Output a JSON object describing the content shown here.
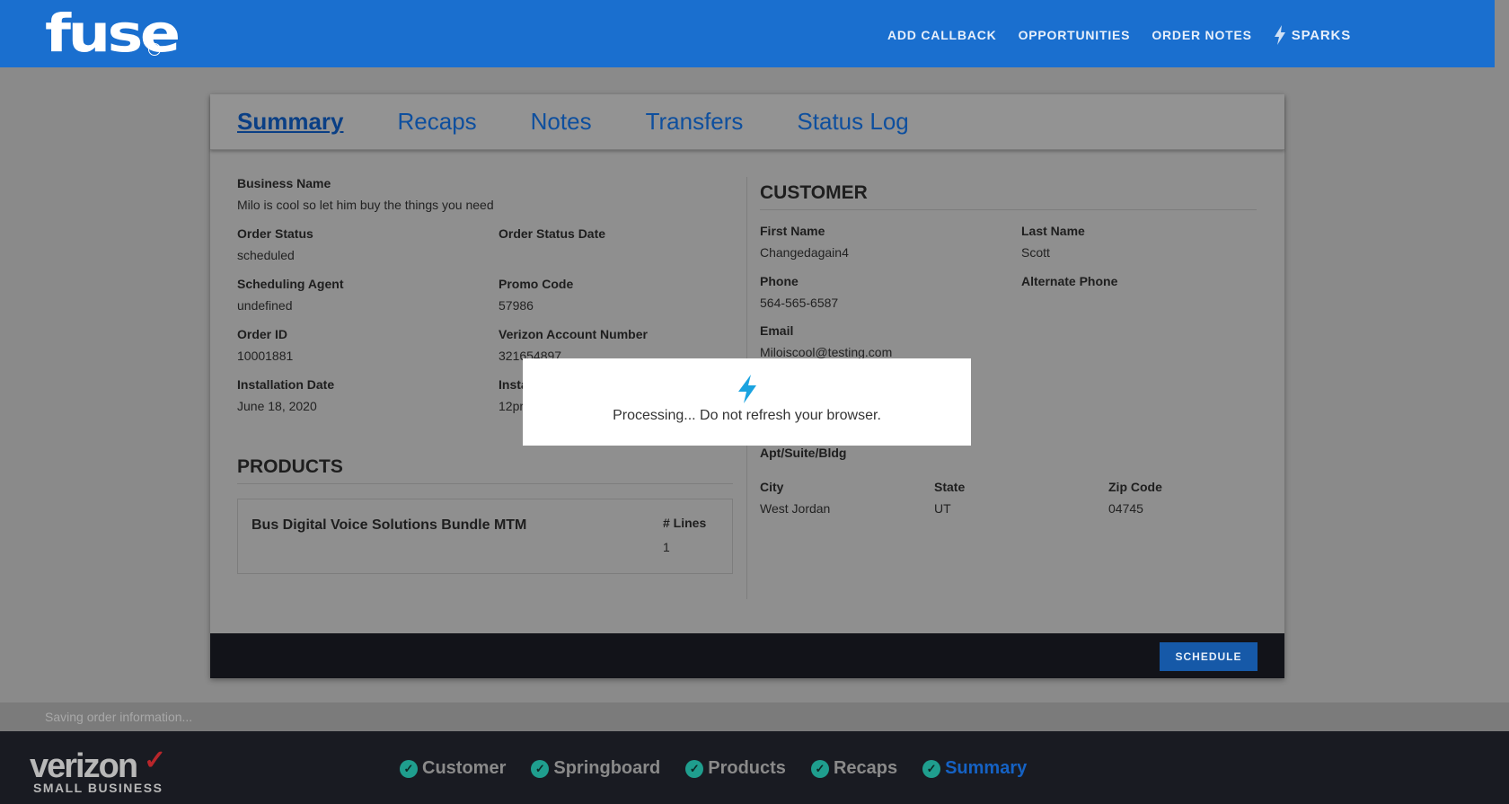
{
  "header": {
    "logo": "fuse",
    "help": "?",
    "nav": [
      "ADD CALLBACK",
      "OPPORTUNITIES",
      "ORDER NOTES"
    ],
    "sparks_label": "SPARKS"
  },
  "tabs": [
    "Summary",
    "Recaps",
    "Notes",
    "Transfers",
    "Status Log"
  ],
  "summary": {
    "business_name": {
      "label": "Business Name",
      "value": "Milo is cool so let him buy the things you need"
    },
    "order_status": {
      "label": "Order Status",
      "value": "scheduled"
    },
    "order_status_date": {
      "label": "Order Status Date",
      "value": ""
    },
    "scheduling_agent": {
      "label": "Scheduling Agent",
      "value": "undefined"
    },
    "promo_code": {
      "label": "Promo Code",
      "value": "57986"
    },
    "order_id": {
      "label": "Order ID",
      "value": "10001881"
    },
    "verizon_account": {
      "label": "Verizon Account Number",
      "value": "321654897"
    },
    "installation_date": {
      "label": "Installation Date",
      "value": "June 18, 2020"
    },
    "installation_time": {
      "label": "Insta",
      "value": "12pr"
    }
  },
  "products": {
    "title": "PRODUCTS",
    "name": "Bus Digital Voice Solutions Bundle MTM",
    "lines_label": "# Lines",
    "lines_value": "1"
  },
  "customer": {
    "title": "CUSTOMER",
    "first_name": {
      "label": "First Name",
      "value": "Changedagain4"
    },
    "last_name": {
      "label": "Last Name",
      "value": "Scott"
    },
    "phone": {
      "label": "Phone",
      "value": "564-565-6587"
    },
    "alt_phone": {
      "label": "Alternate Phone",
      "value": ""
    },
    "email": {
      "label": "Email",
      "value": "Miloiscool@testing.com"
    },
    "apt": {
      "label": "Apt/Suite/Bldg",
      "value": ""
    },
    "city": {
      "label": "City",
      "value": "West Jordan"
    },
    "state": {
      "label": "State",
      "value": "UT"
    },
    "zip": {
      "label": "Zip Code",
      "value": "04745"
    }
  },
  "footer": {
    "schedule": "SCHEDULE"
  },
  "saving_text": "Saving order information...",
  "brand": {
    "name": "verizon",
    "check": "✓",
    "sub": "SMALL BUSINESS"
  },
  "steps": [
    {
      "label": "Customer",
      "check": "✓"
    },
    {
      "label": "Springboard",
      "check": "✓"
    },
    {
      "label": "Products",
      "check": "✓"
    },
    {
      "label": "Recaps",
      "check": "✓"
    },
    {
      "label": "Summary",
      "check": "✓"
    }
  ],
  "modal": {
    "text": "Processing... Do not refresh your browser."
  },
  "colors": {
    "header": "#1a6fcf",
    "accent": "#1562c4",
    "check": "#1f9e8e",
    "bolt": "#1aa3e0"
  }
}
